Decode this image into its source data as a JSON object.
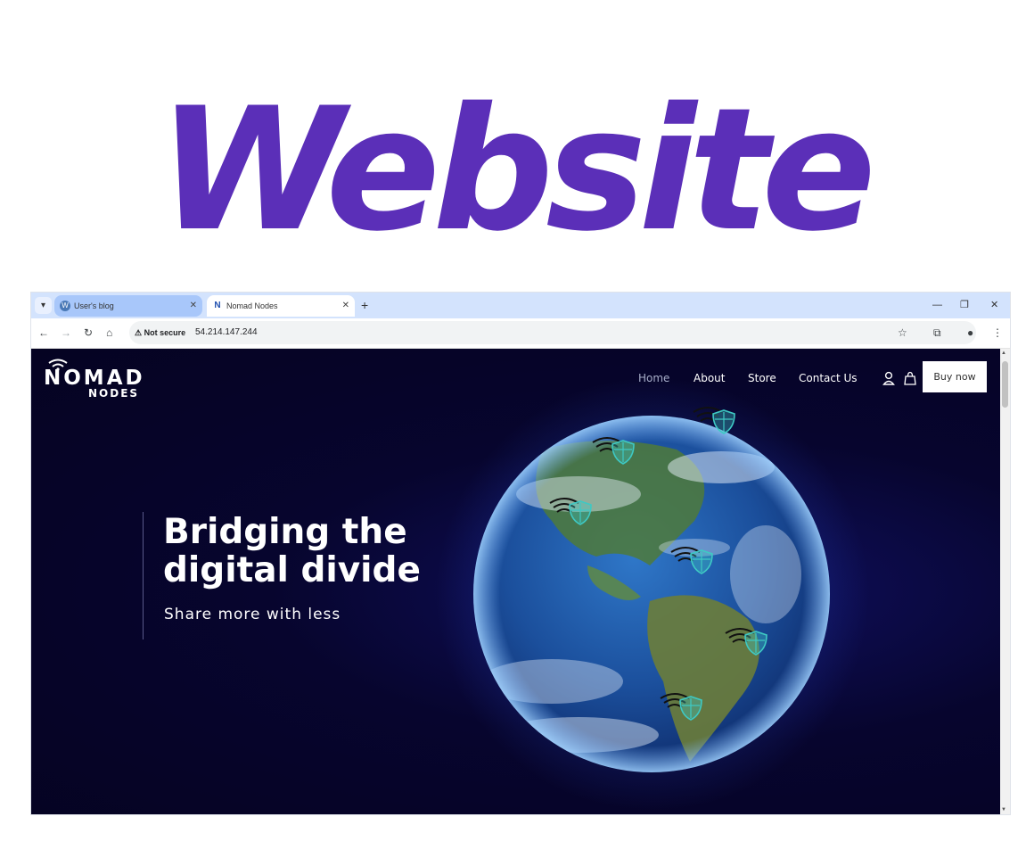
{
  "headline": "Website",
  "browser": {
    "tabs": [
      {
        "label": "User's blog",
        "favicon": "wordpress-icon",
        "active": false
      },
      {
        "label": "Nomad Nodes",
        "favicon": "nomad-n-icon",
        "active": true
      }
    ],
    "security_label": "Not secure",
    "url": "54.214.147.244",
    "icons": {
      "tab_menu": "▾",
      "close": "✕",
      "new_tab": "+",
      "minimize": "—",
      "restore": "❐",
      "back": "←",
      "forward": "→",
      "reload": "↻",
      "home": "⌂",
      "warning": "⚠",
      "star": "☆",
      "extensions": "⧉",
      "profile": "●",
      "more": "⋮",
      "wp": "W",
      "n": "N",
      "scroll_up": "▲",
      "scroll_down": "▼"
    }
  },
  "site": {
    "logo": {
      "top": "NOMAD",
      "bottom": "NODES"
    },
    "nav": [
      {
        "label": "Home",
        "active": true
      },
      {
        "label": "About",
        "active": false
      },
      {
        "label": "Store",
        "active": false
      },
      {
        "label": "Contact Us",
        "active": false
      }
    ],
    "buy_button": "Buy now",
    "hero": {
      "title": "Bridging the digital divide",
      "subtitle": "Share more with less"
    },
    "colors": {
      "background": "#07052e",
      "marker_shield": "#3ec9c4",
      "headline": "#5b2fb8",
      "tab_strip": "#d3e3fd"
    }
  }
}
